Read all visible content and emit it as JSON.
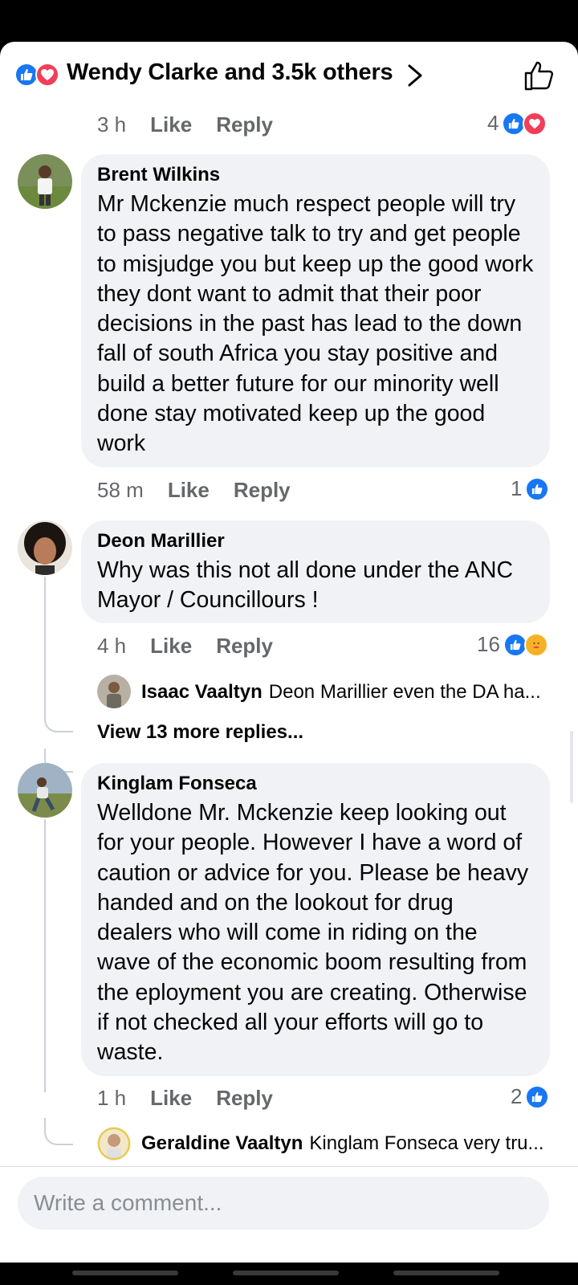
{
  "header": {
    "title": "Wendy Clarke and 3.5k others",
    "reaction_icons": [
      "like-icon",
      "love-icon"
    ]
  },
  "top_comment_meta": {
    "time": "3 h",
    "like": "Like",
    "reply": "Reply",
    "reaction_count": "4"
  },
  "comments": [
    {
      "author": "Brent Wilkins",
      "text": "Mr Mckenzie much respect people will try to pass negative talk to try and get people to misjudge you but keep up the good work they dont want to admit that their poor decisions in the past has lead to the down fall of south Africa you stay positive and build a better future for our minority well done stay motivated keep up the good work",
      "time": "58 m",
      "like": "Like",
      "reply": "Reply",
      "reaction_count": "1"
    },
    {
      "author": "Deon Marillier",
      "text": "Why was this not all done under the ANC Mayor / Councillours !",
      "time": "4 h",
      "like": "Like",
      "reply": "Reply",
      "reaction_count": "16",
      "reply_preview": {
        "author": "Isaac Vaaltyn",
        "text": "Deon Marillier even the DA ha..."
      },
      "view_more": "View 13 more replies..."
    },
    {
      "author": "Kinglam Fonseca",
      "text": "Welldone Mr. Mckenzie keep looking out for your people. However I have a word of caution or advice for you. Please be heavy handed and on the lookout for drug dealers who will come in riding on the wave of the economic boom resulting from the eployment you are creating. Otherwise if not checked all your efforts will go to waste.",
      "time": "1 h",
      "like": "Like",
      "reply": "Reply",
      "reaction_count": "2",
      "reply_preview": {
        "author": "Geraldine Vaaltyn",
        "text": "Kinglam Fonseca very tru..."
      }
    }
  ],
  "composer": {
    "placeholder": "Write a comment..."
  },
  "colors": {
    "like": "#1877f2",
    "love": "#f33e58",
    "care": "#f7b125",
    "bubble": "#f0f2f5",
    "meta": "#65676b"
  }
}
